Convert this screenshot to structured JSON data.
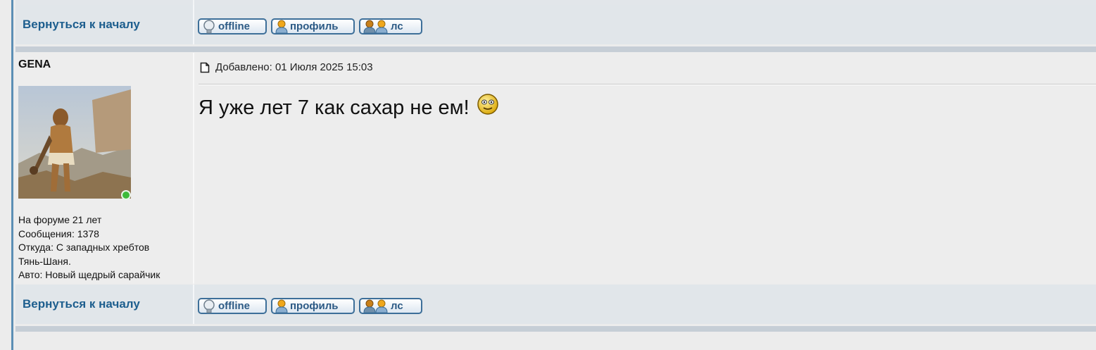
{
  "post": {
    "author": "GENA",
    "added_label": "Добавлено: 01 Июля 2025 15:03",
    "message": "Я уже лет 7 как сахар не ем!",
    "author_info": [
      "На форуме 21 лет",
      "Сообщения: 1378",
      "Откуда: С западных хребтов",
      "Тянь-Шаня.",
      "Авто: Новый щедрый сарайчик"
    ],
    "author_status": "online"
  },
  "nav": {
    "back_to_top": "Вернуться к началу",
    "offline_label": "offline",
    "profile_label": "профиль",
    "pm_label": "лс"
  },
  "colors": {
    "link": "#1d5e8e",
    "button_border": "#3d6f99",
    "left_bar": "#5c8fb5",
    "separator": "#c6ced6"
  },
  "icons": [
    "bulb-icon",
    "user-icon",
    "users-icon",
    "post-icon",
    "smiley-icon",
    "online-indicator"
  ]
}
